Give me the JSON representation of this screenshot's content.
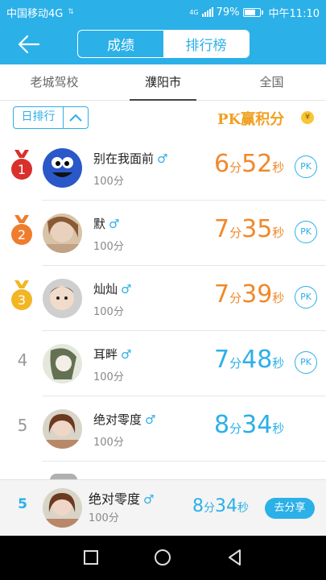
{
  "status": {
    "carrier": "中国移动4G",
    "battery": "79%",
    "time": "中午11:10",
    "battery_level": 0.79
  },
  "header": {
    "back_icon": "arrow-left-icon",
    "seg_scores": "成绩",
    "seg_rank": "排行榜"
  },
  "regions": [
    {
      "label": "老城驾校",
      "active": false
    },
    {
      "label": "濮阳市",
      "active": true
    },
    {
      "label": "全国",
      "active": false
    }
  ],
  "sort": {
    "label": "日排行",
    "icon": "chevron-up-icon"
  },
  "pk_banner": {
    "text": "PK赢积分",
    "coin": "¥"
  },
  "list": [
    {
      "rank": "1",
      "medal_color": "#d9302b",
      "name": "别在我面前",
      "gender": "♂",
      "score": "100分",
      "min": "6",
      "min_unit": "分",
      "sec": "52",
      "sec_unit": "秒",
      "color": "orange",
      "pk": "PK",
      "avatar": "cookie-monster-avatar"
    },
    {
      "rank": "2",
      "medal_color": "#ee7d2d",
      "name": "默",
      "gender": "♂",
      "score": "100分",
      "min": "7",
      "min_unit": "分",
      "sec": "35",
      "sec_unit": "秒",
      "color": "orange",
      "pk": "PK",
      "avatar": "girl-photo-avatar"
    },
    {
      "rank": "3",
      "medal_color": "#f2b623",
      "name": "灿灿",
      "gender": "♂",
      "score": "100分",
      "min": "7",
      "min_unit": "分",
      "sec": "39",
      "sec_unit": "秒",
      "color": "orange",
      "pk": "PK",
      "avatar": "baby-photo-avatar"
    },
    {
      "rank": "4",
      "name": "耳畔",
      "gender": "♂",
      "score": "100分",
      "min": "7",
      "min_unit": "分",
      "sec": "48",
      "sec_unit": "秒",
      "color": "blue",
      "pk": "PK",
      "avatar": "girl-bw-avatar"
    },
    {
      "rank": "5",
      "name": "绝对零度",
      "gender": "♂",
      "score": "100分",
      "min": "8",
      "min_unit": "分",
      "sec": "34",
      "sec_unit": "秒",
      "color": "blue",
      "avatar": "woman-photo-avatar"
    }
  ],
  "self": {
    "rank": "5",
    "name": "绝对零度",
    "gender": "♂",
    "score": "100分",
    "min": "8",
    "min_unit": "分",
    "sec": "34",
    "sec_unit": "秒",
    "share": "去分享"
  },
  "nav": {
    "recent": "square-icon",
    "home": "circle-icon",
    "back": "triangle-back-icon"
  }
}
